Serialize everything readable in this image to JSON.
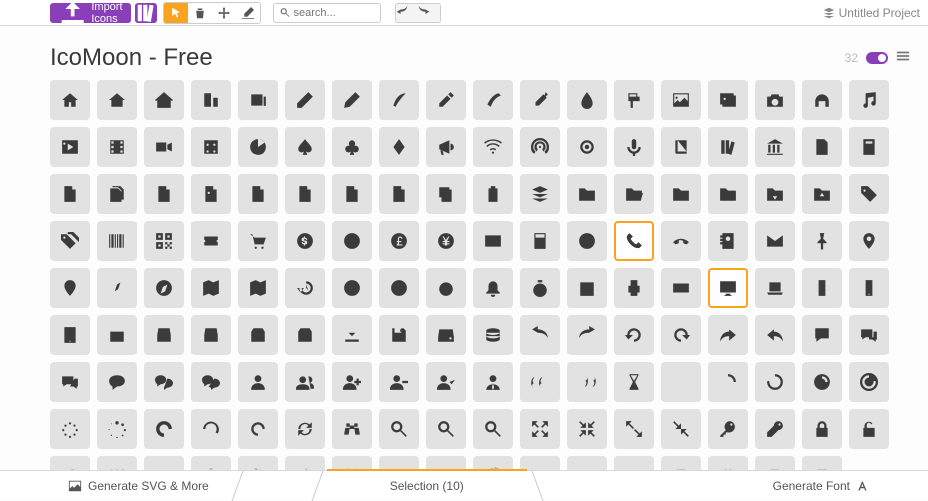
{
  "toolbar": {
    "import_label": "Import Icons",
    "search_placeholder": "search..."
  },
  "project": {
    "title": "Untitled Project"
  },
  "set": {
    "title": "IcoMoon - Free",
    "visible_count": "32"
  },
  "selection": {
    "label": "Selection (10)"
  },
  "footer": {
    "generate_svg": "Generate SVG & More",
    "generate_font": "Generate Font"
  },
  "icons": [
    "home",
    "home2",
    "home3",
    "office",
    "newspaper",
    "pencil",
    "pencil2",
    "quill",
    "pen",
    "blog",
    "eyedropper",
    "droplet",
    "paint-format",
    "image",
    "images",
    "camera",
    "headphones",
    "music",
    "play",
    "film",
    "video-camera",
    "dice",
    "pacman",
    "spades",
    "clubs",
    "diamonds",
    "bullhorn",
    "connection",
    "podcast",
    "feed",
    "mic",
    "book",
    "books",
    "library",
    "file-text",
    "profile",
    "file-empty",
    "files-empty",
    "file-text2",
    "file-picture",
    "file-music",
    "file-play",
    "file-video",
    "file-zip",
    "copy",
    "paste",
    "stack",
    "folder",
    "folder-open",
    "folder-plus",
    "folder-minus",
    "folder-download",
    "folder-upload",
    "price-tag",
    "price-tags",
    "barcode",
    "qrcode",
    "ticket",
    "cart",
    "coin-dollar",
    "coin-euro",
    "coin-pound",
    "coin-yen",
    "credit-card",
    "calculator",
    "lifebuoy",
    "phone",
    "phone-hang-up",
    "address-book",
    "envelop",
    "pushpin",
    "location",
    "location2",
    "compass",
    "compass2",
    "map",
    "map2",
    "history",
    "clock",
    "clock2",
    "alarm",
    "bell",
    "stopwatch",
    "calendar",
    "printer",
    "keyboard",
    "display",
    "laptop",
    "mobile",
    "mobile2",
    "tablet",
    "tv",
    "drawer",
    "drawer2",
    "box-add",
    "box-remove",
    "download",
    "floppy-disk",
    "drive",
    "database",
    "undo",
    "redo",
    "undo2",
    "redo2",
    "forward",
    "reply",
    "bubble",
    "bubbles",
    "bubbles2",
    "bubble2",
    "bubbles3",
    "bubbles4",
    "user",
    "users",
    "user-plus",
    "user-minus",
    "user-check",
    "user-tie",
    "quotes-left",
    "quotes-right",
    "hour-glass",
    "spinner",
    "spinner2",
    "spinner3",
    "spinner4",
    "spinner5",
    "spinner6",
    "spinner7",
    "spinner8",
    "spinner9",
    "spinner10",
    "spinner11",
    "binoculars",
    "search",
    "zoom-in",
    "zoom-out",
    "enlarge",
    "shrink",
    "enlarge2",
    "shrink2",
    "key",
    "key2",
    "lock",
    "unlocked",
    "wrench",
    "equalizer",
    "equalizer2",
    "cog",
    "cogs",
    "hammer",
    "magic-wand",
    "aid-kit",
    "bug",
    "pie-chart",
    "stats-dots",
    "stats-bars",
    "stats-bars2",
    "trophy",
    "gift",
    "glass",
    "glass2"
  ],
  "selected_indices": [
    66,
    86
  ],
  "fade_row_start": 144,
  "chart_data": null
}
